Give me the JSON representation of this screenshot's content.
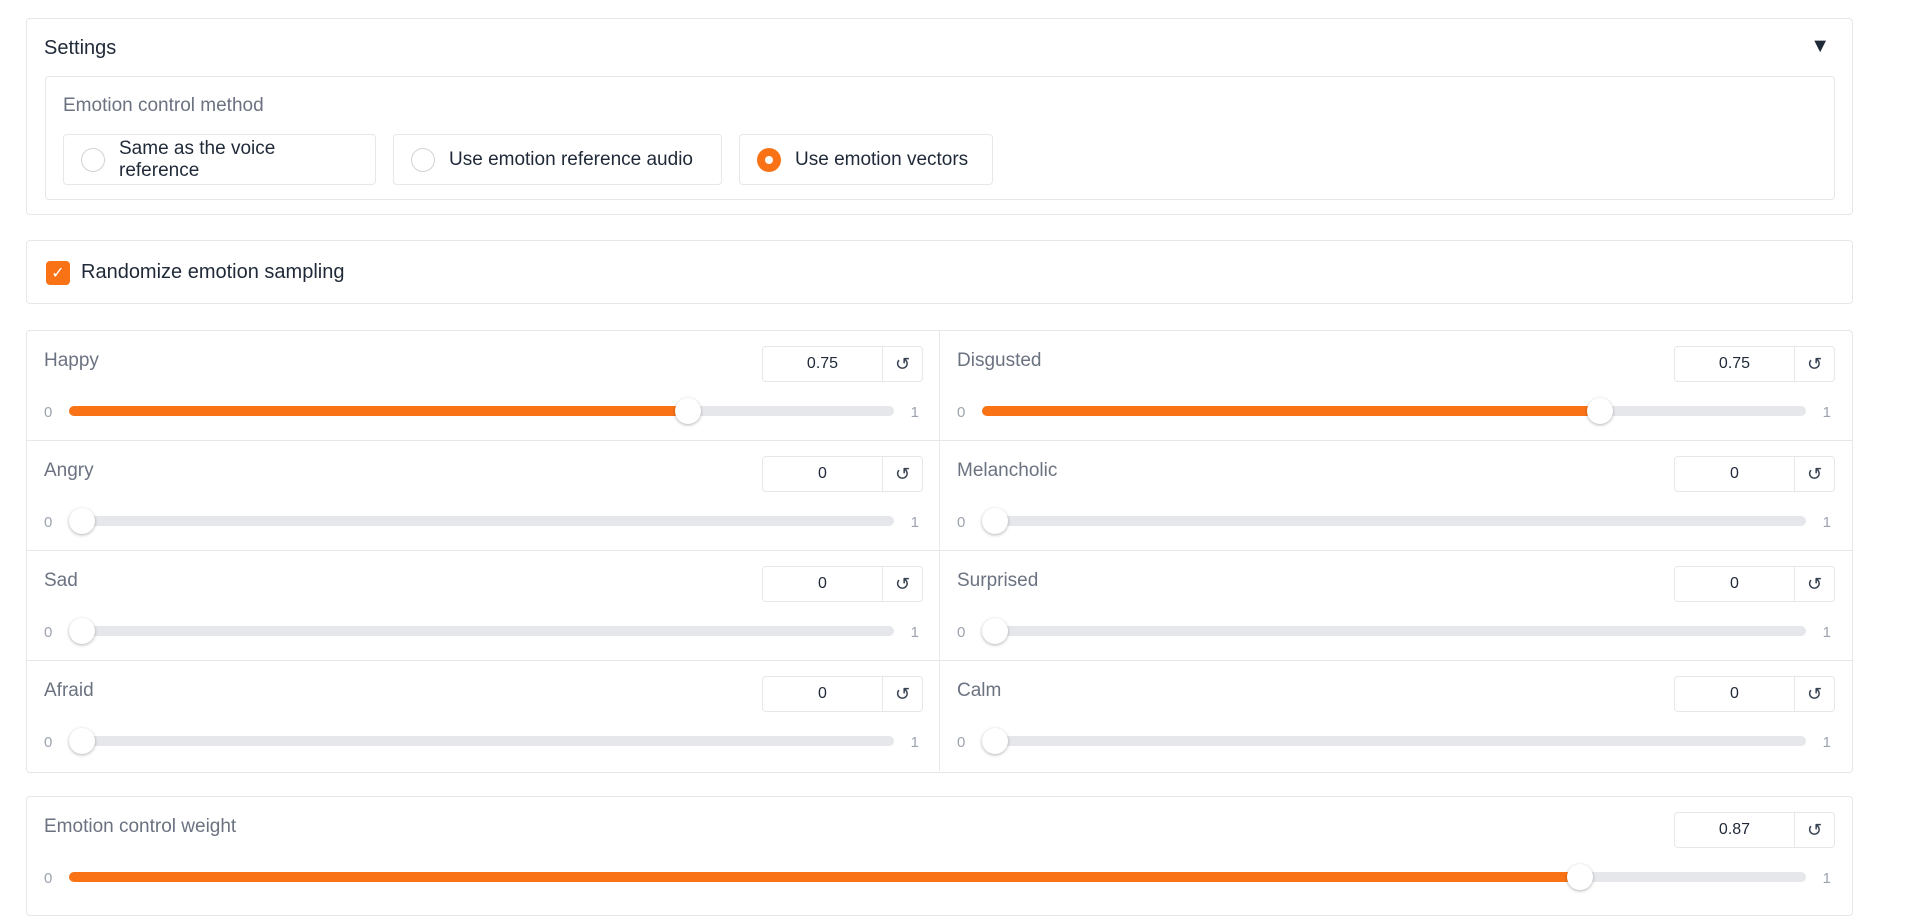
{
  "settings": {
    "title": "Settings",
    "caret": "▼",
    "method_label": "Emotion control method",
    "options": [
      {
        "label": "Same as the voice reference",
        "selected": false
      },
      {
        "label": "Use emotion reference audio",
        "selected": false
      },
      {
        "label": "Use emotion vectors",
        "selected": true
      }
    ]
  },
  "randomize": {
    "label": "Randomize emotion sampling",
    "checked": true
  },
  "emotions": [
    {
      "label": "Happy",
      "value": "0.75",
      "fraction": 0.75,
      "min": "0",
      "max": "1"
    },
    {
      "label": "Disgusted",
      "value": "0.75",
      "fraction": 0.75,
      "min": "0",
      "max": "1"
    },
    {
      "label": "Angry",
      "value": "0",
      "fraction": 0,
      "min": "0",
      "max": "1"
    },
    {
      "label": "Melancholic",
      "value": "0",
      "fraction": 0,
      "min": "0",
      "max": "1"
    },
    {
      "label": "Sad",
      "value": "0",
      "fraction": 0,
      "min": "0",
      "max": "1"
    },
    {
      "label": "Surprised",
      "value": "0",
      "fraction": 0,
      "min": "0",
      "max": "1"
    },
    {
      "label": "Afraid",
      "value": "0",
      "fraction": 0,
      "min": "0",
      "max": "1"
    },
    {
      "label": "Calm",
      "value": "0",
      "fraction": 0,
      "min": "0",
      "max": "1"
    }
  ],
  "weight": {
    "label": "Emotion control weight",
    "value": "0.87",
    "fraction": 0.87,
    "min": "0",
    "max": "1"
  },
  "reset_icon": "↺",
  "check_icon": "✓",
  "colors": {
    "accent": "#f97316",
    "border": "#e5e7eb",
    "track": "#e5e7eb",
    "label": "#6b7280"
  }
}
